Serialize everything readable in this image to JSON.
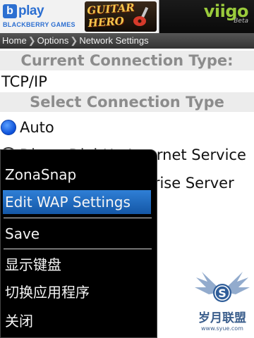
{
  "banner": {
    "bplay_letter": "b",
    "bplay_word": "play",
    "bplay_sub": "BLACKBERRY GAMES",
    "game_title": "GUITAR HERO",
    "brand_name": "viigo",
    "brand_tag": "Beta"
  },
  "breadcrumb": [
    "Home",
    "Options",
    "Network Settings"
  ],
  "current_connection": {
    "header": "Current Connection Type:",
    "value": "TCP/IP"
  },
  "select_connection": {
    "header": "Select Connection Type",
    "options": [
      {
        "label": "Auto",
        "selected": true
      },
      {
        "label": "Direct Dial-Up Internet Service",
        "selected": false
      },
      {
        "label": "BlackBerry Enterprise Server",
        "selected": false
      }
    ]
  },
  "context_menu": {
    "items": [
      {
        "label": "ZonaSnap",
        "highlighted": false
      },
      {
        "label": "Edit WAP Settings",
        "highlighted": true
      },
      {
        "label": "Save",
        "highlighted": false
      },
      {
        "label": "显示键盘",
        "highlighted": false
      },
      {
        "label": "切换应用程序",
        "highlighted": false
      },
      {
        "label": "关闭",
        "highlighted": false
      }
    ]
  },
  "watermark": {
    "badge_letter": "S",
    "text": "岁月联盟",
    "url": "www.syue.com"
  },
  "colors": {
    "brand_green": "#9acb3c",
    "highlight_blue": "#1f6cc2",
    "section_header_bg": "#ececec",
    "radio_selected": "#0b4fd8"
  }
}
